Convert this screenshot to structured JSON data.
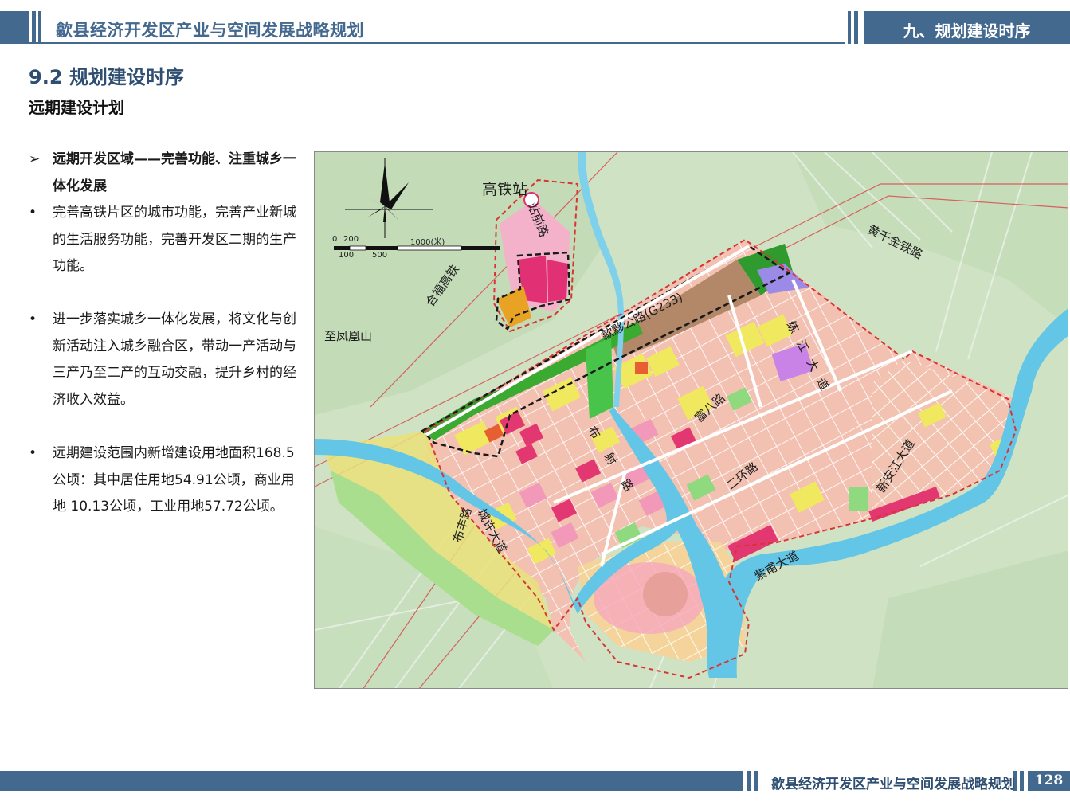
{
  "header": {
    "title": "歙县经济开发区产业与空间发展战略规划",
    "chapter": "九、规划建设时序"
  },
  "section_title": "9.2 规划建设时序",
  "subsection_title": "远期建设计划",
  "bullets": [
    {
      "marker": "➢",
      "text": "远期开发区域——完善功能、注重城乡一体化发展"
    },
    {
      "marker": "•",
      "text": "完善高铁片区的城市功能，完善产业新城的生活服务功能，完善开发区二期的生产功能。"
    },
    {
      "marker": "•",
      "text": "进一步落实城乡一体化发展，将文化与创新活动注入城乡融合区，带动一产活动与三产乃至二产的互动交融，提升乡村的经济收入效益。"
    },
    {
      "marker": "•",
      "text": "远期建设范围内新增建设用地面积168.5公顷：其中居住用地54.91公顷，商业用地 10.13公顷，工业用地57.72公顷。"
    }
  ],
  "map": {
    "labels": {
      "gaotie_station": "高铁站",
      "zhanqian_road": "站前路",
      "hefu_railway": "合福高铁",
      "huangqianjin_railway": "黄千金铁路",
      "shetui_road": "歙黟公路(G233)",
      "zhi_fenghuangshan": "至凤凰山",
      "lianjiang_avenue": "练江大道",
      "fuba_road": "富八路",
      "buhe_road": "布射路",
      "erhuan_road": "二环路",
      "xinanjiang_avenue": "新安江大道",
      "chengxu_avenue": "城许大道",
      "bufeng_road": "布丰路",
      "zidong_avenue": "紫甫大道"
    },
    "scale": {
      "t0": "0",
      "t200": "200",
      "t1000": "1000(米)",
      "t100": "100",
      "t500": "500"
    },
    "colors": {
      "river": "#63c6e6",
      "background": "#cfe3c4",
      "residential": "#f3b9b8",
      "commercial": "#e02e76",
      "industrial": "#b28868",
      "green": "#3aa42e",
      "yellow": "#f1ea6c",
      "boundary": "#d93434",
      "plan_boundary": "#1a1a1a"
    }
  },
  "footer": {
    "title": "歙县经济开发区产业与空间发展战略规划",
    "page": "128"
  }
}
